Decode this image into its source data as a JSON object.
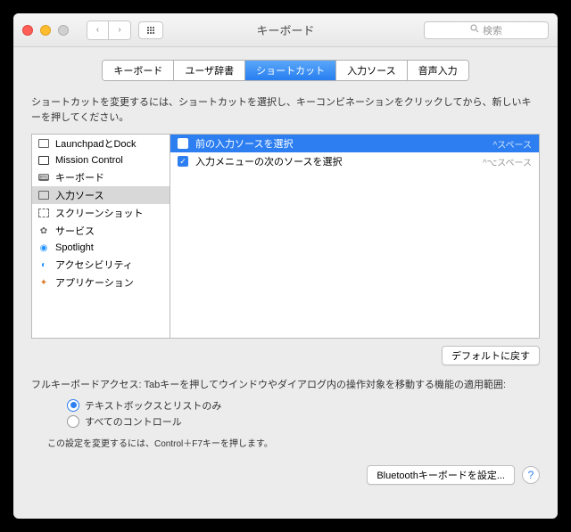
{
  "titlebar": {
    "title": "キーボード",
    "search_placeholder": "検索"
  },
  "tabs": [
    {
      "label": "キーボード"
    },
    {
      "label": "ユーザ辞書"
    },
    {
      "label": "ショートカット"
    },
    {
      "label": "入力ソース"
    },
    {
      "label": "音声入力"
    }
  ],
  "active_tab": 2,
  "instruction": "ショートカットを変更するには、ショートカットを選択し、キーコンビネーションをクリックしてから、新しいキーを押してください。",
  "categories": [
    {
      "label": "LaunchpadとDock"
    },
    {
      "label": "Mission Control"
    },
    {
      "label": "キーボード"
    },
    {
      "label": "入力ソース"
    },
    {
      "label": "スクリーンショット"
    },
    {
      "label": "サービス"
    },
    {
      "label": "Spotlight"
    },
    {
      "label": "アクセシビリティ"
    },
    {
      "label": "アプリケーション"
    }
  ],
  "selected_category": 3,
  "shortcuts": [
    {
      "enabled": false,
      "label": "前の入力ソースを選択",
      "key": "^スペース",
      "selected": true
    },
    {
      "enabled": true,
      "label": "入力メニューの次のソースを選択",
      "key": "^⌥スペース",
      "selected": false
    }
  ],
  "defaults_button": "デフォルトに戻す",
  "access": {
    "label": "フルキーボードアクセス: Tabキーを押してウインドウやダイアログ内の操作対象を移動する機能の適用範囲:",
    "options": [
      {
        "label": "テキストボックスとリストのみ",
        "selected": true
      },
      {
        "label": "すべてのコントロール",
        "selected": false
      }
    ],
    "hint": "この設定を変更するには、Control＋F7キーを押します。"
  },
  "footer": {
    "bluetooth": "Bluetoothキーボードを設定..."
  }
}
